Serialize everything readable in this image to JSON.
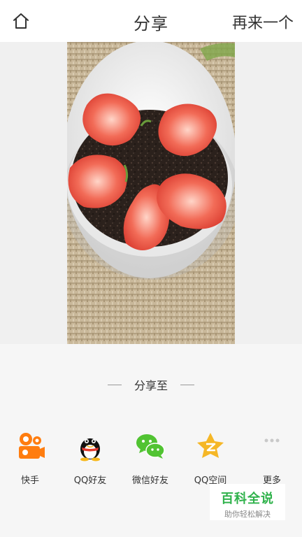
{
  "header": {
    "home_icon": "home-icon",
    "title": "分享",
    "again_label": "再来一个"
  },
  "photo": {
    "subject": "strawberry-dessert-photo"
  },
  "share": {
    "label": "分享至",
    "targets": [
      {
        "icon": "kuaishou-icon",
        "label": "快手",
        "color": "#ff7d0f"
      },
      {
        "icon": "qq-icon",
        "label": "QQ好友",
        "color": "#000000"
      },
      {
        "icon": "wechat-icon",
        "label": "微信好友",
        "color": "#51c332"
      },
      {
        "icon": "qzone-icon",
        "label": "QQ空间",
        "color": "#f5b727"
      },
      {
        "icon": "more-icon",
        "label": "更多",
        "color": "#c9c9c9"
      }
    ]
  },
  "watermark": {
    "title": "百科全说",
    "subtitle": "助你轻松解决"
  }
}
